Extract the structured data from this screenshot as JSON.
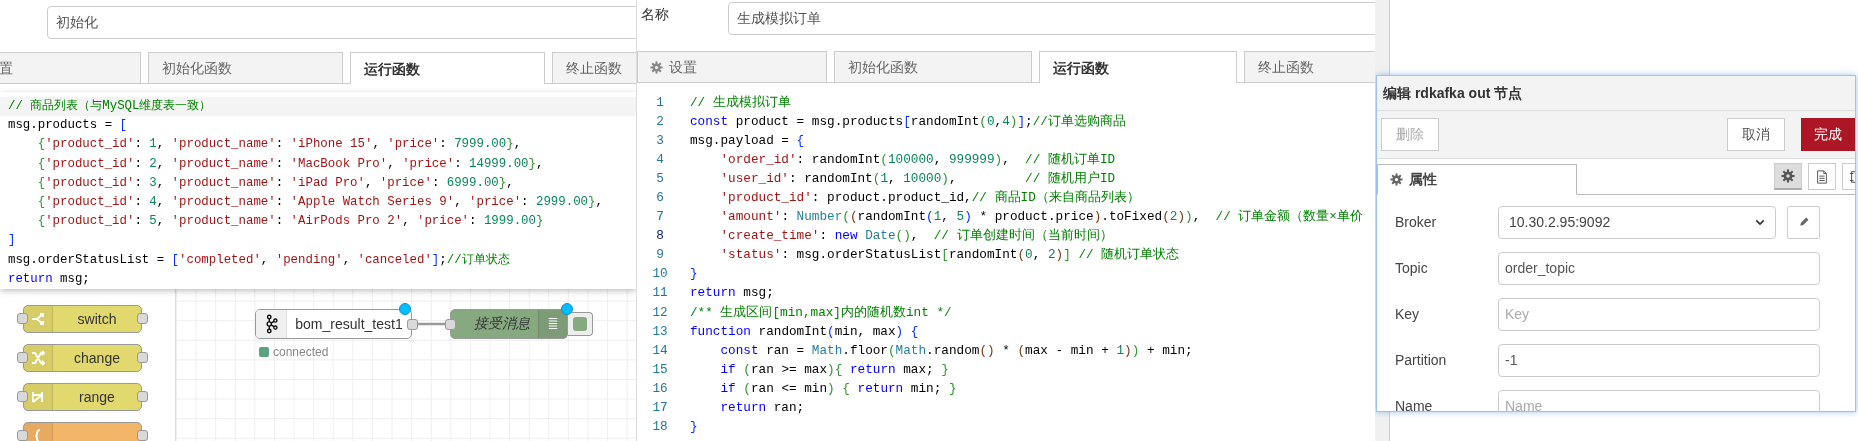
{
  "left_editor": {
    "name_field": {
      "value": "初始化"
    },
    "tabs": [
      {
        "label": "置",
        "selected": false
      },
      {
        "label": "初始化函数",
        "selected": false
      },
      {
        "label": "运行函数",
        "selected": true
      },
      {
        "label": "终止函数",
        "selected": false
      }
    ],
    "code_lines": [
      {
        "active": true,
        "indented": false,
        "tokens": [
          {
            "kind": "c",
            "text": "// 商品列表（与MySQL维度表一致）"
          }
        ]
      },
      {
        "active": false,
        "indented": false,
        "tokens": [
          {
            "kind": "p",
            "text": "msg.products = "
          },
          {
            "kind": "b1",
            "text": "["
          }
        ]
      },
      {
        "active": false,
        "indented": true,
        "tokens": [
          {
            "kind": "b2",
            "text": "{"
          },
          {
            "kind": "s",
            "text": "'product_id'"
          },
          {
            "kind": "p",
            "text": ": "
          },
          {
            "kind": "n",
            "text": "1"
          },
          {
            "kind": "p",
            "text": ", "
          },
          {
            "kind": "s",
            "text": "'product_name'"
          },
          {
            "kind": "p",
            "text": ": "
          },
          {
            "kind": "s",
            "text": "'iPhone 15'"
          },
          {
            "kind": "p",
            "text": ", "
          },
          {
            "kind": "s",
            "text": "'price'"
          },
          {
            "kind": "p",
            "text": ": "
          },
          {
            "kind": "n",
            "text": "7999.00"
          },
          {
            "kind": "b2",
            "text": "}"
          },
          {
            "kind": "p",
            "text": ","
          }
        ]
      },
      {
        "active": false,
        "indented": true,
        "tokens": [
          {
            "kind": "b2",
            "text": "{"
          },
          {
            "kind": "s",
            "text": "'product_id'"
          },
          {
            "kind": "p",
            "text": ": "
          },
          {
            "kind": "n",
            "text": "2"
          },
          {
            "kind": "p",
            "text": ", "
          },
          {
            "kind": "s",
            "text": "'product_name'"
          },
          {
            "kind": "p",
            "text": ": "
          },
          {
            "kind": "s",
            "text": "'MacBook Pro'"
          },
          {
            "kind": "p",
            "text": ", "
          },
          {
            "kind": "s",
            "text": "'price'"
          },
          {
            "kind": "p",
            "text": ": "
          },
          {
            "kind": "n",
            "text": "14999.00"
          },
          {
            "kind": "b2",
            "text": "}"
          },
          {
            "kind": "p",
            "text": ","
          }
        ]
      },
      {
        "active": false,
        "indented": true,
        "tokens": [
          {
            "kind": "b2",
            "text": "{"
          },
          {
            "kind": "s",
            "text": "'product_id'"
          },
          {
            "kind": "p",
            "text": ": "
          },
          {
            "kind": "n",
            "text": "3"
          },
          {
            "kind": "p",
            "text": ", "
          },
          {
            "kind": "s",
            "text": "'product_name'"
          },
          {
            "kind": "p",
            "text": ": "
          },
          {
            "kind": "s",
            "text": "'iPad Pro'"
          },
          {
            "kind": "p",
            "text": ", "
          },
          {
            "kind": "s",
            "text": "'price'"
          },
          {
            "kind": "p",
            "text": ": "
          },
          {
            "kind": "n",
            "text": "6999.00"
          },
          {
            "kind": "b2",
            "text": "}"
          },
          {
            "kind": "p",
            "text": ","
          }
        ]
      },
      {
        "active": false,
        "indented": true,
        "tokens": [
          {
            "kind": "b2",
            "text": "{"
          },
          {
            "kind": "s",
            "text": "'product_id'"
          },
          {
            "kind": "p",
            "text": ": "
          },
          {
            "kind": "n",
            "text": "4"
          },
          {
            "kind": "p",
            "text": ", "
          },
          {
            "kind": "s",
            "text": "'product_name'"
          },
          {
            "kind": "p",
            "text": ": "
          },
          {
            "kind": "s",
            "text": "'Apple Watch Series 9'"
          },
          {
            "kind": "p",
            "text": ", "
          },
          {
            "kind": "s",
            "text": "'price'"
          },
          {
            "kind": "p",
            "text": ": "
          },
          {
            "kind": "n",
            "text": "2999.00"
          },
          {
            "kind": "b2",
            "text": "}"
          },
          {
            "kind": "p",
            "text": ","
          }
        ]
      },
      {
        "active": false,
        "indented": true,
        "tokens": [
          {
            "kind": "b2",
            "text": "{"
          },
          {
            "kind": "s",
            "text": "'product_id'"
          },
          {
            "kind": "p",
            "text": ": "
          },
          {
            "kind": "n",
            "text": "5"
          },
          {
            "kind": "p",
            "text": ", "
          },
          {
            "kind": "s",
            "text": "'product_name'"
          },
          {
            "kind": "p",
            "text": ": "
          },
          {
            "kind": "s",
            "text": "'AirPods Pro 2'"
          },
          {
            "kind": "p",
            "text": ", "
          },
          {
            "kind": "s",
            "text": "'price'"
          },
          {
            "kind": "p",
            "text": ": "
          },
          {
            "kind": "n",
            "text": "1999.00"
          },
          {
            "kind": "b2",
            "text": "}"
          }
        ]
      },
      {
        "active": false,
        "indented": false,
        "tokens": [
          {
            "kind": "b1",
            "text": "]"
          }
        ]
      },
      {
        "active": false,
        "indented": false,
        "tokens": [
          {
            "kind": "p",
            "text": "msg.orderStatusList = "
          },
          {
            "kind": "b1",
            "text": "["
          },
          {
            "kind": "s",
            "text": "'completed'"
          },
          {
            "kind": "p",
            "text": ", "
          },
          {
            "kind": "s",
            "text": "'pending'"
          },
          {
            "kind": "p",
            "text": ", "
          },
          {
            "kind": "s",
            "text": "'canceled'"
          },
          {
            "kind": "b1",
            "text": "]"
          },
          {
            "kind": "p",
            "text": ";"
          },
          {
            "kind": "c",
            "text": "//订单状态"
          }
        ]
      },
      {
        "active": false,
        "indented": false,
        "tokens": [
          {
            "kind": "k",
            "text": "return"
          },
          {
            "kind": "p",
            "text": " msg;"
          }
        ]
      }
    ]
  },
  "palette": {
    "nodes": [
      {
        "kind": "switch",
        "label": "switch",
        "color": "#e2d96e"
      },
      {
        "kind": "change",
        "label": "change",
        "color": "#e2d96e"
      },
      {
        "kind": "range",
        "label": "range",
        "color": "#e2d96e"
      },
      {
        "kind": "template",
        "color": "#f3b567"
      }
    ]
  },
  "flow": {
    "nodes": [
      {
        "kind": "kafka",
        "label": "bom_result_test1",
        "changed": true,
        "status": {
          "color": "#5aa47f",
          "text": "connected"
        }
      },
      {
        "kind": "debug",
        "label": "接受消息",
        "changed": true,
        "active": true
      }
    ]
  },
  "middle_editor": {
    "name_label": "名称",
    "name_field": {
      "value": "生成模拟订单"
    },
    "tabs": [
      {
        "label": "设置",
        "selected": false
      },
      {
        "label": "初始化函数",
        "selected": false
      },
      {
        "label": "运行函数",
        "selected": true
      },
      {
        "label": "终止函数",
        "selected": false
      }
    ],
    "code_lines": [
      {
        "number": "1",
        "active": false,
        "indented": false,
        "tokens": [
          {
            "kind": "c",
            "text": "// 生成模拟订单"
          }
        ]
      },
      {
        "number": "2",
        "active": false,
        "indented": false,
        "tokens": [
          {
            "kind": "k",
            "text": "const"
          },
          {
            "kind": "p",
            "text": " product = msg.products"
          },
          {
            "kind": "b1",
            "text": "["
          },
          {
            "kind": "p",
            "text": "randomInt"
          },
          {
            "kind": "b2",
            "text": "("
          },
          {
            "kind": "n",
            "text": "0"
          },
          {
            "kind": "p",
            "text": ","
          },
          {
            "kind": "n",
            "text": "4"
          },
          {
            "kind": "b2",
            "text": ")"
          },
          {
            "kind": "b1",
            "text": "]"
          },
          {
            "kind": "p",
            "text": ";"
          },
          {
            "kind": "c",
            "text": "//订单选购商品"
          }
        ]
      },
      {
        "number": "3",
        "active": false,
        "indented": false,
        "tokens": [
          {
            "kind": "p",
            "text": "msg.payload = "
          },
          {
            "kind": "b1",
            "text": "{"
          }
        ]
      },
      {
        "number": "4",
        "active": false,
        "indented": true,
        "tokens": [
          {
            "kind": "s",
            "text": "'order_id'"
          },
          {
            "kind": "p",
            "text": ": randomInt"
          },
          {
            "kind": "b2",
            "text": "("
          },
          {
            "kind": "n",
            "text": "100000"
          },
          {
            "kind": "p",
            "text": ", "
          },
          {
            "kind": "n",
            "text": "999999"
          },
          {
            "kind": "b2",
            "text": ")"
          },
          {
            "kind": "p",
            "text": ",  "
          },
          {
            "kind": "c",
            "text": "// 随机订单ID"
          }
        ]
      },
      {
        "number": "5",
        "active": false,
        "indented": true,
        "tokens": [
          {
            "kind": "s",
            "text": "'user_id'"
          },
          {
            "kind": "p",
            "text": ": randomInt"
          },
          {
            "kind": "b2",
            "text": "("
          },
          {
            "kind": "n",
            "text": "1"
          },
          {
            "kind": "p",
            "text": ", "
          },
          {
            "kind": "n",
            "text": "10000"
          },
          {
            "kind": "b2",
            "text": ")"
          },
          {
            "kind": "p",
            "text": ",         "
          },
          {
            "kind": "c",
            "text": "// 随机用户ID"
          }
        ]
      },
      {
        "number": "6",
        "active": false,
        "indented": true,
        "tokens": [
          {
            "kind": "s",
            "text": "'product_id'"
          },
          {
            "kind": "p",
            "text": ": product.product_id,"
          },
          {
            "kind": "c",
            "text": "// 商品ID（来自商品列表）"
          }
        ]
      },
      {
        "number": "7",
        "active": false,
        "indented": true,
        "tokens": [
          {
            "kind": "s",
            "text": "'amount'"
          },
          {
            "kind": "p",
            "text": ": "
          },
          {
            "kind": "t",
            "text": "Number"
          },
          {
            "kind": "b2",
            "text": "("
          },
          {
            "kind": "b3",
            "text": "("
          },
          {
            "kind": "p",
            "text": "randomInt"
          },
          {
            "kind": "b1",
            "text": "("
          },
          {
            "kind": "n",
            "text": "1"
          },
          {
            "kind": "p",
            "text": ", "
          },
          {
            "kind": "n",
            "text": "5"
          },
          {
            "kind": "b1",
            "text": ")"
          },
          {
            "kind": "p",
            "text": " * product.price"
          },
          {
            "kind": "b3",
            "text": ")"
          },
          {
            "kind": "p",
            "text": ".toFixed"
          },
          {
            "kind": "b3",
            "text": "("
          },
          {
            "kind": "n",
            "text": "2"
          },
          {
            "kind": "b3",
            "text": ")"
          },
          {
            "kind": "b2",
            "text": ")"
          },
          {
            "kind": "p",
            "text": ",  "
          },
          {
            "kind": "c",
            "text": "// 订单金额（数量×单价"
          }
        ]
      },
      {
        "number": "8",
        "active": true,
        "indented": true,
        "tokens": [
          {
            "kind": "s",
            "text": "'create_time'"
          },
          {
            "kind": "p",
            "text": ": "
          },
          {
            "kind": "k",
            "text": "new"
          },
          {
            "kind": "t",
            "text": " Date"
          },
          {
            "kind": "b2",
            "text": "()"
          },
          {
            "kind": "p",
            "text": ",  "
          },
          {
            "kind": "c",
            "text": "// 订单创建时间（当前时间）"
          }
        ]
      },
      {
        "number": "9",
        "active": false,
        "indented": true,
        "tokens": [
          {
            "kind": "s",
            "text": "'status'"
          },
          {
            "kind": "p",
            "text": ": msg.orderStatusList"
          },
          {
            "kind": "b2",
            "text": "["
          },
          {
            "kind": "p",
            "text": "randomInt"
          },
          {
            "kind": "b3",
            "text": "("
          },
          {
            "kind": "n",
            "text": "0"
          },
          {
            "kind": "p",
            "text": ", "
          },
          {
            "kind": "n",
            "text": "2"
          },
          {
            "kind": "b3",
            "text": ")"
          },
          {
            "kind": "b2",
            "text": "]"
          },
          {
            "kind": "c",
            "text": " // 随机订单状态"
          }
        ]
      },
      {
        "number": "10",
        "active": false,
        "indented": false,
        "tokens": [
          {
            "kind": "b1",
            "text": "}"
          }
        ]
      },
      {
        "number": "11",
        "active": false,
        "indented": false,
        "tokens": [
          {
            "kind": "k",
            "text": "return"
          },
          {
            "kind": "p",
            "text": " msg;"
          }
        ]
      },
      {
        "number": "12",
        "active": false,
        "indented": false,
        "tokens": [
          {
            "kind": "c",
            "text": "/** 生成区间[min,max]内的随机数int */"
          }
        ]
      },
      {
        "number": "13",
        "active": false,
        "indented": false,
        "tokens": [
          {
            "kind": "k",
            "text": "function"
          },
          {
            "kind": "p",
            "text": " randomInt"
          },
          {
            "kind": "b1",
            "text": "("
          },
          {
            "kind": "p",
            "text": "min, max"
          },
          {
            "kind": "b1",
            "text": ")"
          },
          {
            "kind": "b1",
            "text": " {"
          }
        ]
      },
      {
        "number": "14",
        "active": false,
        "indented": true,
        "tokens": [
          {
            "kind": "k",
            "text": "const"
          },
          {
            "kind": "p",
            "text": " ran = "
          },
          {
            "kind": "t",
            "text": "Math"
          },
          {
            "kind": "p",
            "text": ".floor"
          },
          {
            "kind": "b2",
            "text": "("
          },
          {
            "kind": "t",
            "text": "Math"
          },
          {
            "kind": "p",
            "text": ".random"
          },
          {
            "kind": "b3",
            "text": "()"
          },
          {
            "kind": "p",
            "text": " * "
          },
          {
            "kind": "b3",
            "text": "("
          },
          {
            "kind": "p",
            "text": "max - min + "
          },
          {
            "kind": "n",
            "text": "1"
          },
          {
            "kind": "b3",
            "text": ")"
          },
          {
            "kind": "b2",
            "text": ")"
          },
          {
            "kind": "p",
            "text": " + min;"
          }
        ]
      },
      {
        "number": "15",
        "active": false,
        "indented": true,
        "tokens": [
          {
            "kind": "k",
            "text": "if"
          },
          {
            "kind": "b2",
            "text": " ("
          },
          {
            "kind": "p",
            "text": "ran >= max"
          },
          {
            "kind": "b2",
            "text": ")"
          },
          {
            "kind": "b2",
            "text": "{"
          },
          {
            "kind": "k",
            "text": " return"
          },
          {
            "kind": "p",
            "text": " max; "
          },
          {
            "kind": "b2",
            "text": "}"
          }
        ]
      },
      {
        "number": "16",
        "active": false,
        "indented": true,
        "tokens": [
          {
            "kind": "k",
            "text": "if"
          },
          {
            "kind": "b2",
            "text": " ("
          },
          {
            "kind": "p",
            "text": "ran <= min"
          },
          {
            "kind": "b2",
            "text": ")"
          },
          {
            "kind": "b2",
            "text": " {"
          },
          {
            "kind": "k",
            "text": " return"
          },
          {
            "kind": "p",
            "text": " min; "
          },
          {
            "kind": "b2",
            "text": "}"
          }
        ]
      },
      {
        "number": "17",
        "active": false,
        "indented": true,
        "tokens": [
          {
            "kind": "k",
            "text": "return"
          },
          {
            "kind": "p",
            "text": " ran;"
          }
        ]
      },
      {
        "number": "18",
        "active": false,
        "indented": false,
        "tokens": [
          {
            "kind": "b1",
            "text": "}"
          }
        ]
      }
    ]
  },
  "dialog": {
    "title": "编辑 rdkafka out 节点",
    "buttons": [
      {
        "kind": "delete",
        "label": "删除",
        "disabled": true
      },
      {
        "kind": "cancel",
        "label": "取消",
        "disabled": false
      },
      {
        "kind": "primary",
        "label": "完成",
        "disabled": false
      }
    ],
    "tabs": [
      {
        "label": "属性",
        "selected": true
      }
    ],
    "tool_tabs": [
      {
        "kind": "properties",
        "selected": true
      },
      {
        "kind": "description",
        "selected": false
      },
      {
        "kind": "appearance",
        "selected": false
      }
    ],
    "fields": [
      {
        "kind": "select",
        "label": "Broker",
        "value": "10.30.2.95:9092"
      },
      {
        "kind": "input",
        "label": "Topic",
        "value": "order_topic"
      },
      {
        "kind": "input",
        "label": "Key",
        "placeholder": "Key"
      },
      {
        "kind": "input",
        "label": "Partition",
        "value": "-1"
      },
      {
        "kind": "input",
        "label": "Name",
        "placeholder": "Name"
      }
    ]
  }
}
